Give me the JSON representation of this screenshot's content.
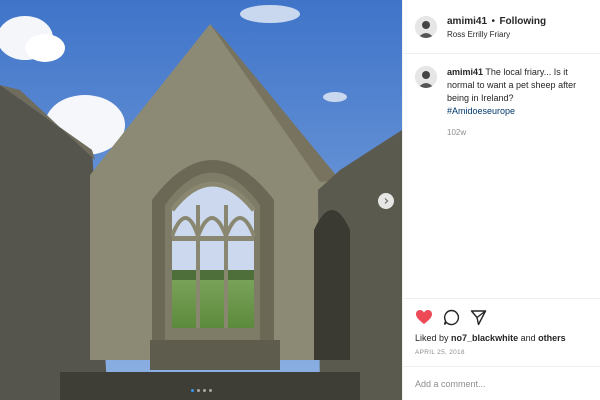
{
  "post": {
    "author": "amimi41",
    "separator": "•",
    "follow_label": "Following",
    "location": "Ross Errilly Friary",
    "caption_username": "amimi41",
    "caption_text": "The local friary... Is it normal to want a pet sheep after being in Ireland?",
    "hashtag": "#Amidoeseurope",
    "time_ago": "102w",
    "liked_by_prefix": "Liked by",
    "liked_by_user": "no7_blackwhite",
    "liked_by_and": "and",
    "liked_by_others": "others",
    "date": "APRIL 25, 2018",
    "comment_placeholder": "Add a comment...",
    "carousel_dots": 4,
    "carousel_active": 1
  },
  "icons": {
    "like": "heart-icon",
    "comment": "comment-bubble-icon",
    "share": "paper-plane-icon",
    "next": "chevron-right-icon"
  },
  "colors": {
    "like": "#ed4956",
    "link": "#00376b",
    "carousel_active": "#3897f0"
  }
}
